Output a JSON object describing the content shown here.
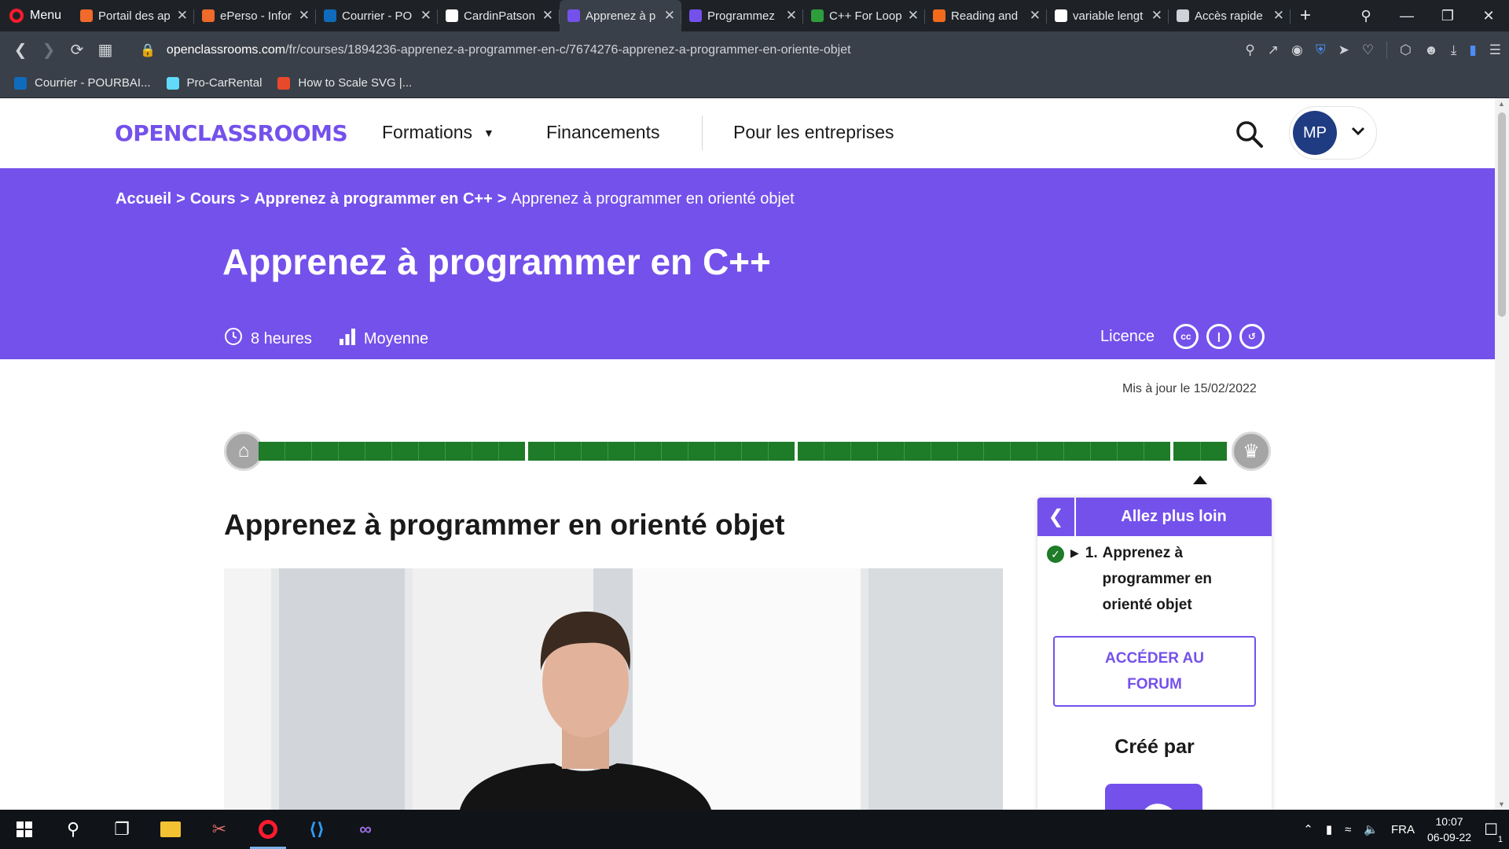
{
  "browser": {
    "menu_label": "Menu",
    "tabs": [
      {
        "title": "Portail des ap",
        "color": "#f06a2a",
        "active": false
      },
      {
        "title": "ePerso - Infor",
        "color": "#f06a2a",
        "active": false
      },
      {
        "title": "Courrier - PO",
        "color": "#0f6cbd",
        "active": false
      },
      {
        "title": "CardinPatson",
        "color": "#ffffff",
        "active": false
      },
      {
        "title": "Apprenez à p",
        "color": "#7451eb",
        "active": true
      },
      {
        "title": "Programmez",
        "color": "#7451eb",
        "active": false
      },
      {
        "title": "C++ For Loop",
        "color": "#2e9e3c",
        "active": false
      },
      {
        "title": "Reading and",
        "color": "#f26b1d",
        "active": false
      },
      {
        "title": "variable lengt",
        "color": "#ffffff",
        "active": false
      },
      {
        "title": "Accès rapide",
        "color": "#cfd3d8",
        "active": false
      }
    ],
    "url_host": "openclassrooms.com",
    "url_path": "/fr/courses/1894236-apprenez-a-programmer-en-c/7674276-apprenez-a-programmer-en-oriente-objet",
    "bookmarks": [
      {
        "label": "Courrier - POURBAI...",
        "color": "#0f6cbd"
      },
      {
        "label": "Pro-CarRental",
        "color": "#61dafb"
      },
      {
        "label": "How to Scale SVG |...",
        "color": "#e8492b"
      }
    ]
  },
  "site": {
    "logo": "OPENCLASSROOMS",
    "nav": {
      "formations": "Formations",
      "financements": "Financements",
      "entreprises": "Pour les entreprises"
    },
    "user_initials": "MP"
  },
  "hero": {
    "breadcrumb": {
      "home": "Accueil",
      "courses": "Cours",
      "course": "Apprenez à programmer en C++",
      "current": "Apprenez à programmer en orienté objet",
      "separator": ">"
    },
    "title": "Apprenez à programmer en C++",
    "duration": "8 heures",
    "level": "Moyenne",
    "licence_label": "Licence"
  },
  "content": {
    "updated": "Mis à jour le 15/02/2022",
    "progress": {
      "segments": [
        {
          "cells": 10,
          "completed": 1.0
        },
        {
          "cells": 10,
          "completed": 1.0
        },
        {
          "cells": 14,
          "completed": 1.0
        },
        {
          "cells": 2,
          "completed": 1.0
        }
      ],
      "current_marker_segment": 4
    },
    "chapter_title": "Apprenez à programmer en orienté objet"
  },
  "side_panel": {
    "header": "Allez plus loin",
    "item_number": "1.",
    "item_label": "Apprenez à programmer en orienté objet",
    "forum_button": "ACCÉDER AU FORUM",
    "created_by": "Créé par"
  },
  "taskbar": {
    "language": "FRA",
    "time": "10:07",
    "date": "06-09-22",
    "notifications": "1"
  }
}
